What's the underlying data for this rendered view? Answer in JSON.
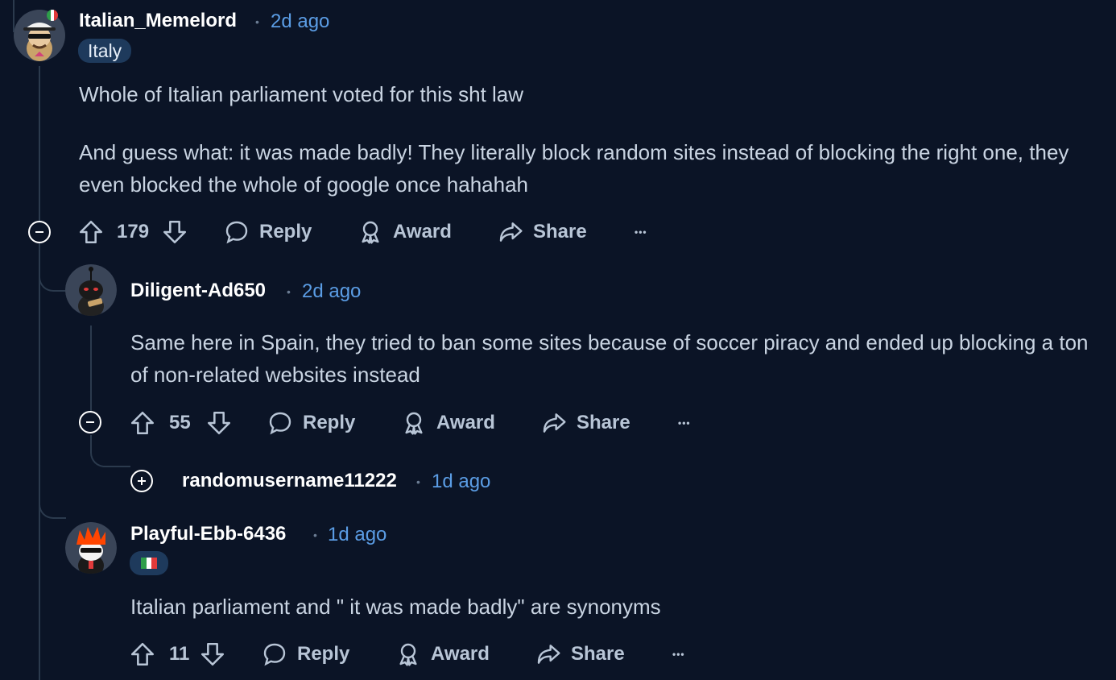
{
  "comments": [
    {
      "author": "Italian_Memelord",
      "separator": "•",
      "time": "2d ago",
      "flair": "Italy",
      "body": [
        "Whole of Italian parliament voted for this sht law",
        "And guess what: it was made badly! They literally block random sites instead of blocking the right one, they even blocked the whole of google once hahahah"
      ],
      "votes": "179",
      "actions": {
        "reply": "Reply",
        "award": "Award",
        "share": "Share",
        "more": "•••"
      }
    },
    {
      "author": "Diligent-Ad650",
      "separator": "•",
      "time": "2d ago",
      "body": [
        "Same here in Spain, they tried to ban some sites because of soccer piracy and ended up blocking a ton of non-related websites instead"
      ],
      "votes": "55",
      "actions": {
        "reply": "Reply",
        "award": "Award",
        "share": "Share",
        "more": "•••"
      }
    },
    {
      "author": "randomusername11222",
      "separator": "•",
      "time": "1d ago",
      "collapsed": true
    },
    {
      "author": "Playful-Ebb-6436",
      "separator": "•",
      "time": "1d ago",
      "flair_icon": "italy-flag-icon",
      "body": [
        "Italian parliament and \" it was made badly\" are synonyms"
      ],
      "votes": "11",
      "actions": {
        "reply": "Reply",
        "award": "Award",
        "share": "Share",
        "more": "•••"
      }
    }
  ],
  "colors": {
    "background": "#0b1426",
    "time": "#5b9de5",
    "flair_bg": "#1e3a5c",
    "thread_line": "#2b3a4d"
  }
}
